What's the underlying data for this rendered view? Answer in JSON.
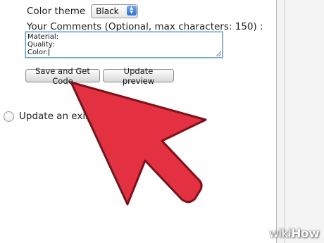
{
  "form": {
    "theme_label": "Color theme",
    "theme_value": "Black",
    "comments_label": "Your Comments (Optional, max characters: 150) :",
    "comments_lines": [
      "Material:",
      "Quality:",
      "Color:"
    ]
  },
  "buttons": {
    "save_label": "Save and Get Code",
    "update_label": "Update preview"
  },
  "radio": {
    "label": "Update an exis"
  },
  "watermark": {
    "text_wiki": "wiki",
    "text_how": "How"
  },
  "colors": {
    "arrow_fill": "#e43142",
    "arrow_stroke": "#7a1219",
    "select_accent": "#3b7be0",
    "textarea_focus": "#6e9fd6"
  },
  "icons": {
    "select_arrows": "up-down-chevron-icon",
    "pointer": "red-arrow-pointer-icon"
  }
}
